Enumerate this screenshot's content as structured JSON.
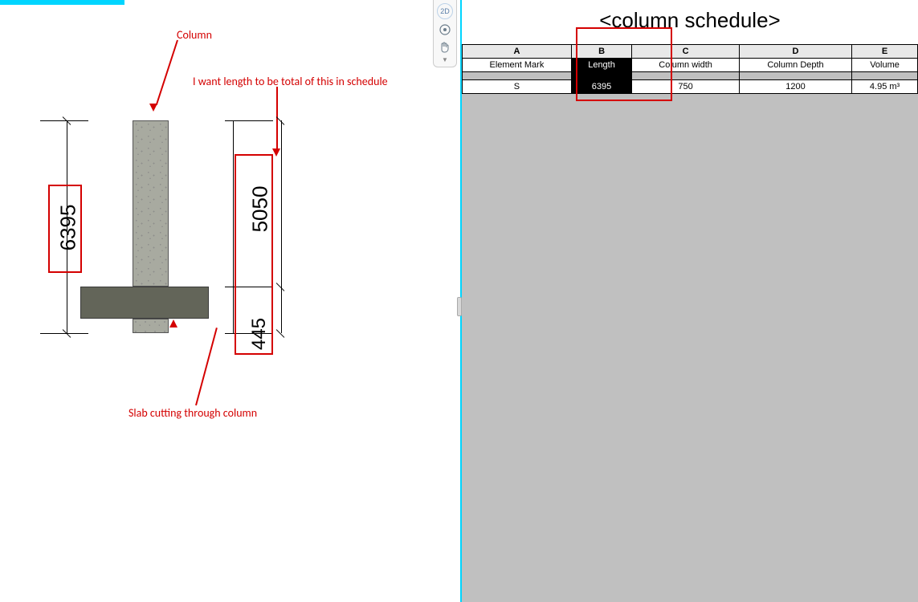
{
  "left": {
    "toolbar2d": "2D",
    "column_label": "Column",
    "length_note": "I want length to be total of this in schedule",
    "slab_label": "Slab cutting through column",
    "dim_total": "6395",
    "dim_upper": "5050",
    "dim_lower": "445"
  },
  "schedule": {
    "title": "<column schedule>",
    "letters": [
      "A",
      "B",
      "C",
      "D",
      "E"
    ],
    "headers": [
      "Element Mark",
      "Length",
      "Column width",
      "Column Depth",
      "Volume"
    ],
    "row": {
      "mark": "S",
      "length": "6395",
      "width": "750",
      "depth": "1200",
      "volume": "4.95 m³"
    }
  }
}
